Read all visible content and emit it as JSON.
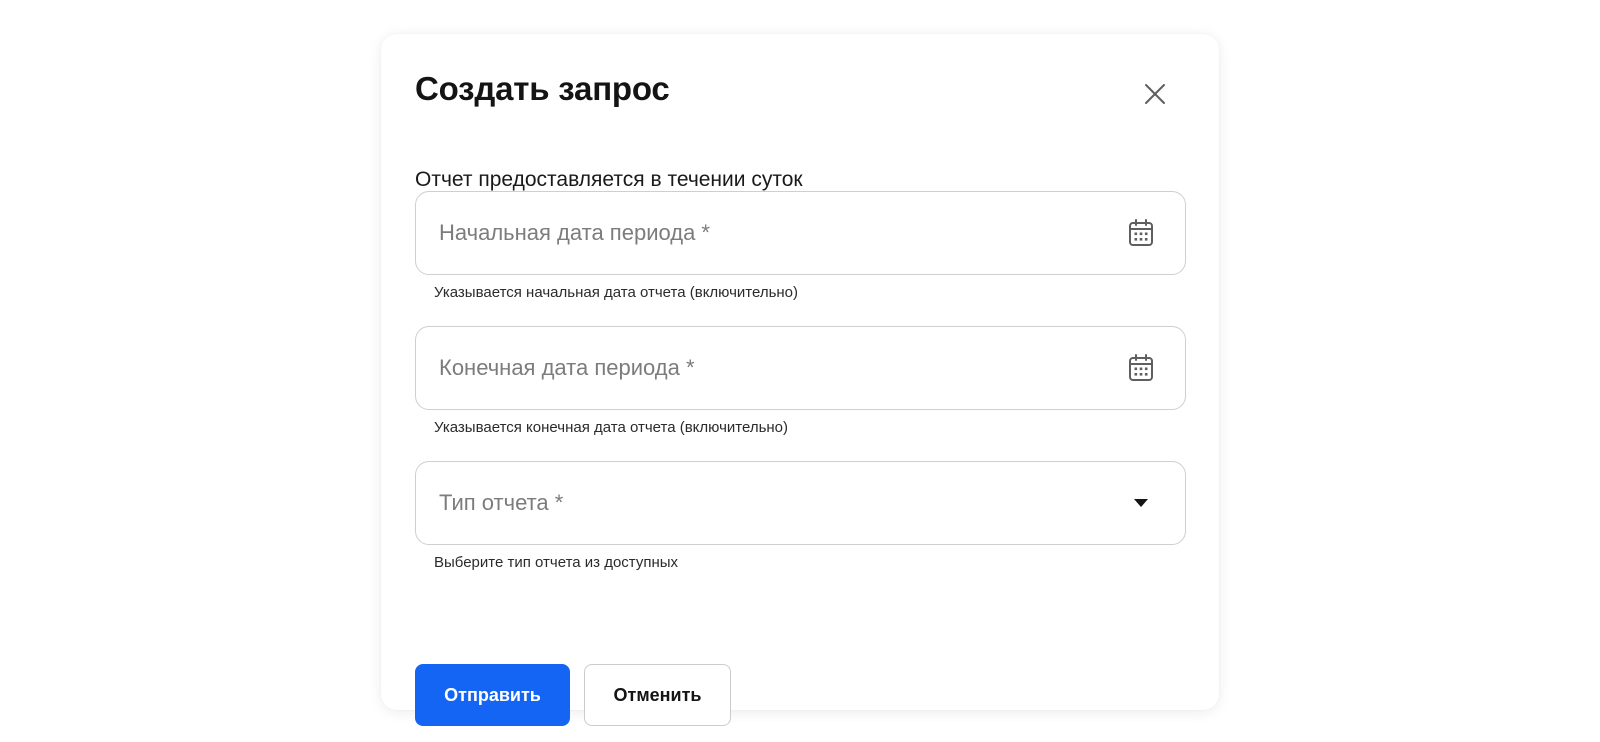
{
  "dialog": {
    "title": "Создать запрос",
    "subtitle": "Отчет предоставляется в течении суток",
    "close_icon": "close-icon"
  },
  "fields": {
    "start_date": {
      "placeholder": "Начальная дата периода *",
      "value": "",
      "helper": "Указывается начальная дата отчета (включительно)",
      "icon": "calendar-icon"
    },
    "end_date": {
      "placeholder": "Конечная дата периода *",
      "value": "",
      "helper": "Указывается конечная дата отчета (включительно)",
      "icon": "calendar-icon"
    },
    "report_type": {
      "placeholder": "Тип отчета *",
      "value": "",
      "helper": "Выберите тип отчета из доступных",
      "icon": "caret-down-icon"
    }
  },
  "actions": {
    "submit_label": "Отправить",
    "cancel_label": "Отменить"
  },
  "colors": {
    "primary": "#1565f5",
    "border": "#cfcfcf",
    "placeholder": "#7c7c7c"
  }
}
